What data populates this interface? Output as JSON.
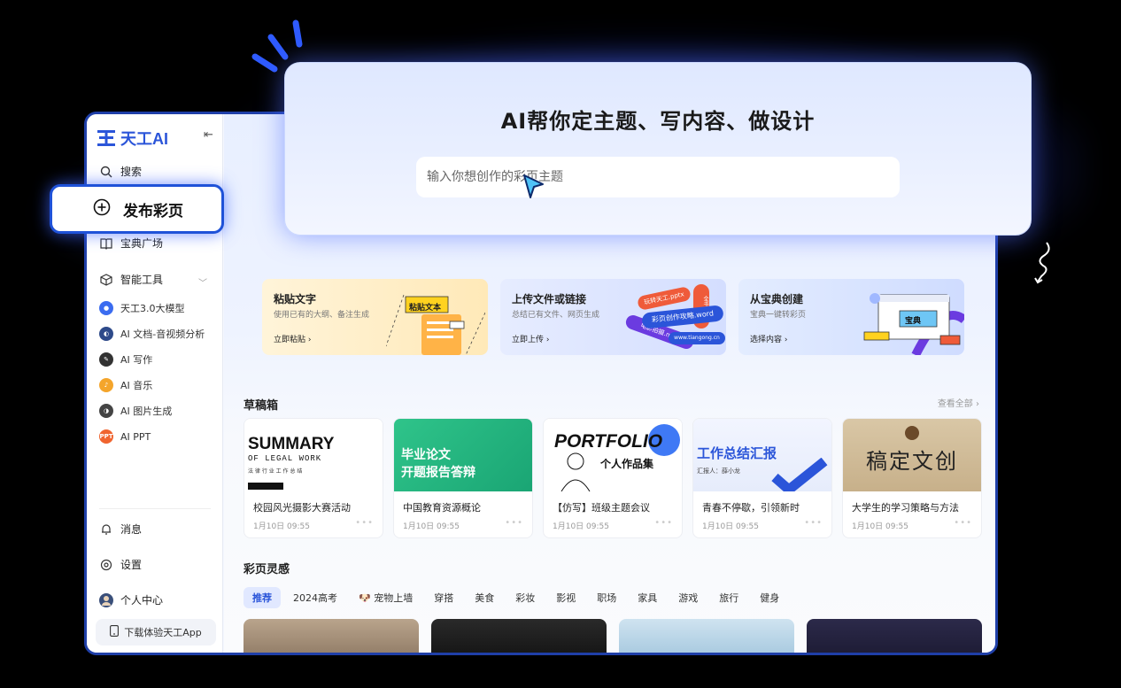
{
  "brand": {
    "name": "天工AI"
  },
  "hero": {
    "title": "AI帮你定主题、写内容、做设计",
    "input_placeholder": "输入你想创作的彩页主题"
  },
  "publish_button": {
    "label": "发布彩页"
  },
  "sidebar": {
    "search": "搜索",
    "plaza": "宝典广场",
    "tools_label": "智能工具",
    "tools": [
      {
        "label": "天工3.0大模型",
        "color": "#3b6cf0"
      },
      {
        "label": "AI 文档-音视频分析",
        "color": "#2e4a8a"
      },
      {
        "label": "AI 写作",
        "color": "#333333"
      },
      {
        "label": "AI 音乐",
        "color": "#f4a52b"
      },
      {
        "label": "AI 图片生成",
        "color": "#444444"
      },
      {
        "label": "AI PPT",
        "color": "#f0642f",
        "badge": "PPT"
      }
    ],
    "messages": "消息",
    "settings": "设置",
    "profile": "个人中心",
    "download": "下载体验天工App"
  },
  "upload_cards": [
    {
      "title": "粘贴文字",
      "subtitle": "使用已有的大纲、备注生成",
      "action": "立即粘贴 ›",
      "tag": "粘贴文本"
    },
    {
      "title": "上传文件或链接",
      "subtitle": "总结已有文件、网页生成",
      "action": "立即上传 ›",
      "tags": [
        "玩转天工.pptx",
        "彩页创作攻略.word",
        "电影拍摄.mov",
        "www.tiangong.cn",
        "全书.ppt"
      ]
    },
    {
      "title": "从宝典创建",
      "subtitle": "宝典一键转彩页",
      "action": "选择内容 ›",
      "tag": "宝典"
    }
  ],
  "drafts": {
    "title": "草稿箱",
    "see_all": "查看全部 ›",
    "items": [
      {
        "name": "校园风光摄影大赛活动",
        "date": "1月10日 09:55",
        "thumb_title": "SUMMARY",
        "thumb_sub": "OF LEGAL WORK",
        "thumb_cn": "法 律 行 业 工 作 总 结"
      },
      {
        "name": "中国教育资源概论",
        "date": "1月10日 09:55",
        "thumb_title": "毕业论文",
        "thumb_sub": "开题报告答辩"
      },
      {
        "name": "【仿写】班级主题会议",
        "date": "1月10日 09:55",
        "thumb_title": "PORTFOLIO",
        "thumb_sub": "个人作品集"
      },
      {
        "name": "青春不停歇，引领新时",
        "date": "1月10日 09:55",
        "thumb_title": "工作总结汇报",
        "thumb_sub": "汇报人：薛小龙"
      },
      {
        "name": "大学生的学习策略与方法",
        "date": "1月10日 09:55",
        "thumb_title": "稿定文创"
      }
    ]
  },
  "inspiration": {
    "title": "彩页灵感",
    "tabs": [
      "推荐",
      "2024高考",
      "🐶 宠物上墙",
      "穿搭",
      "美食",
      "彩妆",
      "影视",
      "职场",
      "家具",
      "游戏",
      "旅行",
      "健身"
    ]
  }
}
